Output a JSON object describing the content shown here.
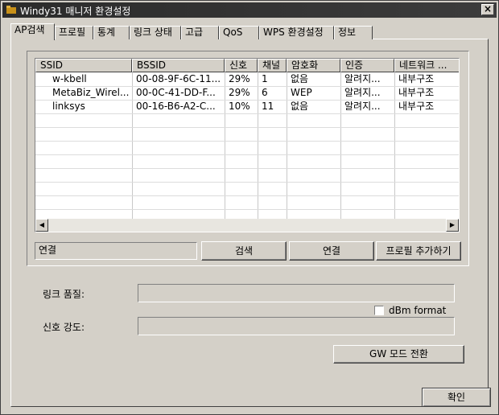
{
  "window": {
    "title": "Windy31 매니저 환경설정",
    "close_glyph": "×"
  },
  "tabs": [
    "AP검색",
    "프로필",
    "통계",
    "링크 상태",
    "고급",
    "QoS",
    "WPS 환경설정",
    "정보"
  ],
  "ap_list": {
    "columns": [
      "SSID",
      "BSSID",
      "신호",
      "채널",
      "암호화",
      "인증",
      "네트워크 ..."
    ],
    "rows": [
      [
        "w-kbell",
        "00-08-9F-6C-11...",
        "29%",
        "1",
        "없음",
        "알려지...",
        "내부구조"
      ],
      [
        "MetaBiz_Wirel...",
        "00-0C-41-DD-F...",
        "29%",
        "6",
        "WEP",
        "알려지...",
        "내부구조"
      ],
      [
        "linksys",
        "00-16-B6-A2-C...",
        "10%",
        "11",
        "없음",
        "알려지...",
        "내부구조"
      ]
    ],
    "scroll_left": "◀",
    "scroll_right": "▶"
  },
  "status_text": "연결",
  "buttons": {
    "search": "검색",
    "connect": "연결",
    "add_profile": "프로필 추가하기",
    "gw_mode": "GW 모드 전환",
    "ok": "확인"
  },
  "link_quality_label": "링크 품질:",
  "signal_strength_label": "신호 강도:",
  "dbm_format_label": "dBm format",
  "dbm_format_checked": false
}
